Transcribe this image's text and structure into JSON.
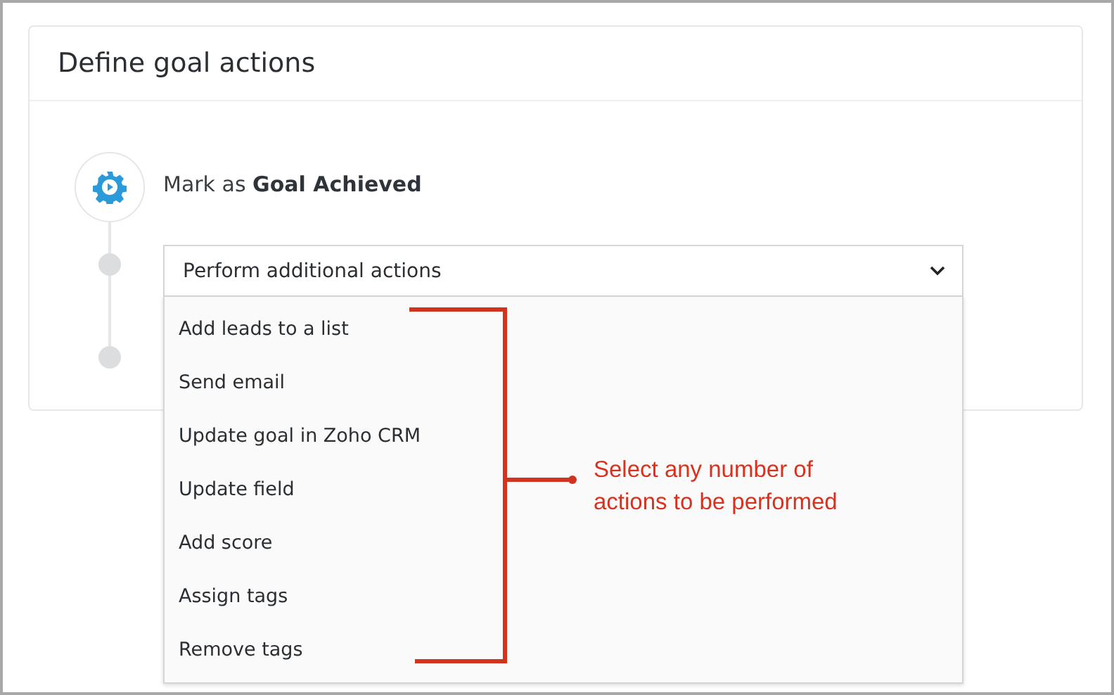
{
  "title": "Define goal actions",
  "step": {
    "label": "Mark as **Goal Achieved**"
  },
  "dropdown": {
    "value": "Perform additional actions",
    "expanded": true,
    "options": [
      "Add leads to a list",
      "Send email",
      "Update goal in Zoho CRM",
      "Update field",
      "Add score",
      "Assign tags",
      "Remove tags"
    ]
  },
  "annotation": {
    "text": "Select any number of actions to be performed"
  }
}
